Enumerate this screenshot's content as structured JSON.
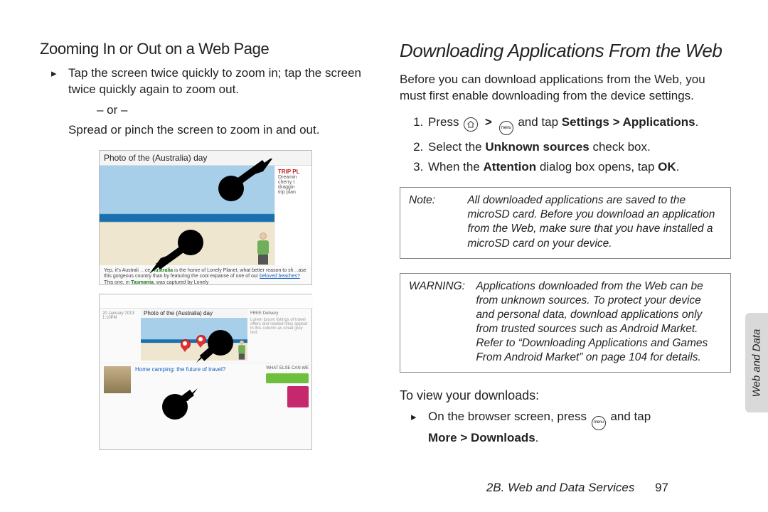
{
  "left": {
    "heading": "Zooming In or Out on a Web Page",
    "bullet1": "Tap the screen twice quickly to zoom in; tap the screen twice quickly again to zoom out.",
    "or": "– or –",
    "bullet1b": "Spread or pinch the screen to zoom in and out.",
    "fig1": {
      "titlebar": "Photo of the (Australia) day",
      "trip": "TRIP PL",
      "side_lines": "Dreamin\ncherry t\ndraggin\ntrip plan",
      "cap_pre": "Yep, it's Australi",
      "cap_hl1": "Australia",
      "cap_mid": " is the home of Lonely Planet, what better reason to sh",
      "cap_mid2": "ase this gorgeous country than by featuring the cool expanse of one of our ",
      "cap_link": "beloved beaches?",
      "cap_post": " This one, in ",
      "cap_hl2": "Tasmania",
      "cap_end": ", was captured by Lonely"
    },
    "fig2": {
      "pcap": "Photo of the (Australia) day",
      "lower_text": "Home camping: the future of travel?",
      "free_del": "FREE Delivery",
      "camp_hdr": "WHAT ELSE CAN WE"
    }
  },
  "right": {
    "heading": "Downloading Applications From the Web",
    "intro": "Before you can download applications from the Web, you must first enable downloading from the device settings.",
    "step1_pre": "Press ",
    "step1_mid": " and tap ",
    "step1_b": "Settings > Applications",
    "step1_end": ".",
    "step2_a": "Select the ",
    "step2_b": "Unknown sources",
    "step2_c": " check box.",
    "step3_a": "When the ",
    "step3_b": "Attention",
    "step3_c": " dialog box opens, tap ",
    "step3_d": "OK",
    "step3_e": ".",
    "note_lbl": "Note:",
    "note_txt": "All downloaded applications are saved to the microSD card. Before you download an application from the Web, make sure that you have installed a microSD card on your device.",
    "warn_lbl": "WARNING:",
    "warn_txt": "Applications downloaded from the Web can be from unknown sources. To protect your device and personal data, download applications only from trusted sources such as Android Market. Refer to “Downloading Applications and Games From Android Market” on page 104 for details.",
    "sub3": "To view your downloads:",
    "view_a": "On the browser screen, press ",
    "view_b": " and tap ",
    "view_c": "More > Downloads",
    "view_d": "."
  },
  "footer": {
    "section": "2B. Web and Data Services",
    "page": "97"
  },
  "sidetab": "Web and Data",
  "icons": {
    "gt": ">"
  }
}
